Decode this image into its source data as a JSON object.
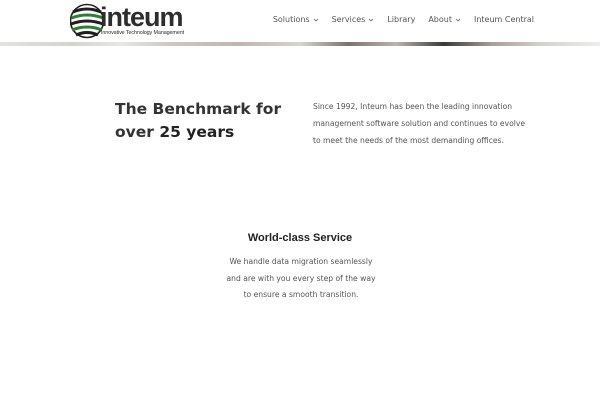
{
  "header": {
    "logo": {
      "word": "inteum",
      "tagline": "Innovative Technology Management"
    },
    "nav": [
      {
        "label": "Solutions",
        "has_dropdown": true
      },
      {
        "label": "Services",
        "has_dropdown": true
      },
      {
        "label": "Library",
        "has_dropdown": false
      },
      {
        "label": "About",
        "has_dropdown": true
      },
      {
        "label": "Inteum Central",
        "has_dropdown": false
      }
    ]
  },
  "benchmark": {
    "title_prefix": "The Benchmark for over ",
    "title_highlight": "25 years",
    "description": "Since 1992, Inteum has been the leading innovation management software solution and continues to evolve to meet the needs of the most demanding offices."
  },
  "service": {
    "title": "World-class Service",
    "description": "We handle data migration seamlessly and are with you every step of the way to ensure a smooth transition."
  },
  "colors": {
    "text_dark": "#222222",
    "text_body": "#555555",
    "logo_green": "#2e7d32"
  }
}
